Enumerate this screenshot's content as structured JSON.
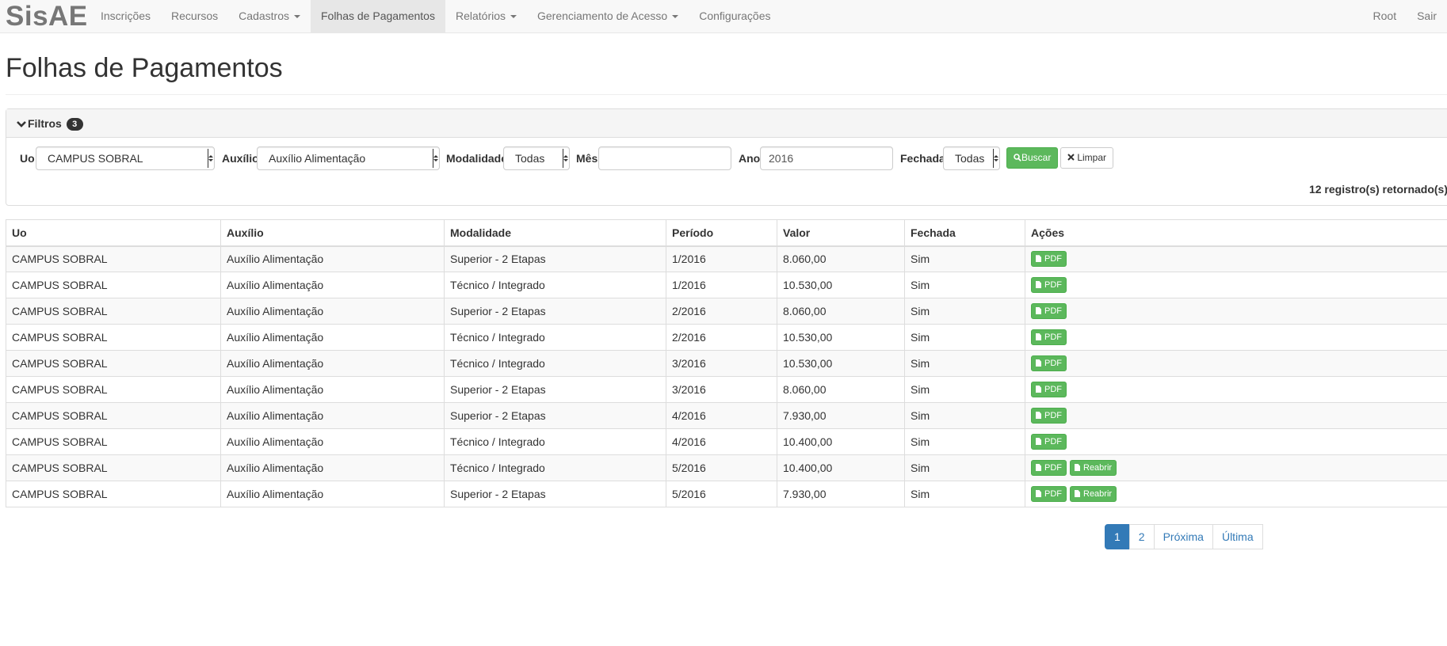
{
  "app": {
    "brand": "SisAE"
  },
  "nav": {
    "items": [
      {
        "label": "Inscrições",
        "dropdown": false,
        "active": false
      },
      {
        "label": "Recursos",
        "dropdown": false,
        "active": false
      },
      {
        "label": "Cadastros",
        "dropdown": true,
        "active": false
      },
      {
        "label": "Folhas de Pagamentos",
        "dropdown": false,
        "active": true
      },
      {
        "label": "Relatórios",
        "dropdown": true,
        "active": false
      },
      {
        "label": "Gerenciamento de Acesso",
        "dropdown": true,
        "active": false
      },
      {
        "label": "Configurações",
        "dropdown": false,
        "active": false
      }
    ],
    "right": {
      "user": "Root",
      "logout": "Sair"
    }
  },
  "page": {
    "title": "Folhas de Pagamentos"
  },
  "filters": {
    "heading": "Filtros",
    "count": "3",
    "uo": {
      "label": "Uo",
      "value": "CAMPUS SOBRAL"
    },
    "auxilio": {
      "label": "Auxílio",
      "value": "Auxílio Alimentação"
    },
    "modalidade": {
      "label": "Modalidade",
      "value": "Todas"
    },
    "mes": {
      "label": "Mês",
      "value": ""
    },
    "ano": {
      "label": "Ano",
      "value": "2016"
    },
    "fechada": {
      "label": "Fechada",
      "value": "Todas"
    },
    "search_button": "Buscar",
    "clear_button": "Limpar",
    "records_count": "12",
    "records_text": "registro(s) retornado(s)"
  },
  "table": {
    "headers": [
      "Uo",
      "Auxílio",
      "Modalidade",
      "Período",
      "Valor",
      "Fechada",
      "Ações"
    ],
    "rows": [
      {
        "uo": "CAMPUS SOBRAL",
        "auxilio": "Auxílio Alimentação",
        "modalidade": "Superior - 2 Etapas",
        "periodo": "1/2016",
        "valor": "8.060,00",
        "fechada": "Sim",
        "reabrir": false
      },
      {
        "uo": "CAMPUS SOBRAL",
        "auxilio": "Auxílio Alimentação",
        "modalidade": "Técnico / Integrado",
        "periodo": "1/2016",
        "valor": "10.530,00",
        "fechada": "Sim",
        "reabrir": false
      },
      {
        "uo": "CAMPUS SOBRAL",
        "auxilio": "Auxílio Alimentação",
        "modalidade": "Superior - 2 Etapas",
        "periodo": "2/2016",
        "valor": "8.060,00",
        "fechada": "Sim",
        "reabrir": false
      },
      {
        "uo": "CAMPUS SOBRAL",
        "auxilio": "Auxílio Alimentação",
        "modalidade": "Técnico / Integrado",
        "periodo": "2/2016",
        "valor": "10.530,00",
        "fechada": "Sim",
        "reabrir": false
      },
      {
        "uo": "CAMPUS SOBRAL",
        "auxilio": "Auxílio Alimentação",
        "modalidade": "Técnico / Integrado",
        "periodo": "3/2016",
        "valor": "10.530,00",
        "fechada": "Sim",
        "reabrir": false
      },
      {
        "uo": "CAMPUS SOBRAL",
        "auxilio": "Auxílio Alimentação",
        "modalidade": "Superior - 2 Etapas",
        "periodo": "3/2016",
        "valor": "8.060,00",
        "fechada": "Sim",
        "reabrir": false
      },
      {
        "uo": "CAMPUS SOBRAL",
        "auxilio": "Auxílio Alimentação",
        "modalidade": "Superior - 2 Etapas",
        "periodo": "4/2016",
        "valor": "7.930,00",
        "fechada": "Sim",
        "reabrir": false
      },
      {
        "uo": "CAMPUS SOBRAL",
        "auxilio": "Auxílio Alimentação",
        "modalidade": "Técnico / Integrado",
        "periodo": "4/2016",
        "valor": "10.400,00",
        "fechada": "Sim",
        "reabrir": false
      },
      {
        "uo": "CAMPUS SOBRAL",
        "auxilio": "Auxílio Alimentação",
        "modalidade": "Técnico / Integrado",
        "periodo": "5/2016",
        "valor": "10.400,00",
        "fechada": "Sim",
        "reabrir": true
      },
      {
        "uo": "CAMPUS SOBRAL",
        "auxilio": "Auxílio Alimentação",
        "modalidade": "Superior - 2 Etapas",
        "periodo": "5/2016",
        "valor": "7.930,00",
        "fechada": "Sim",
        "reabrir": true
      }
    ],
    "actions": {
      "pdf_label": "PDF",
      "reopen_label": "Reabrir"
    }
  },
  "pagination": {
    "pages": [
      "1",
      "2"
    ],
    "active": "1",
    "next": "Próxima",
    "last": "Última"
  },
  "colors": {
    "success": "#5cb85c",
    "primary": "#337ab7",
    "navbar_bg": "#f8f8f8"
  }
}
